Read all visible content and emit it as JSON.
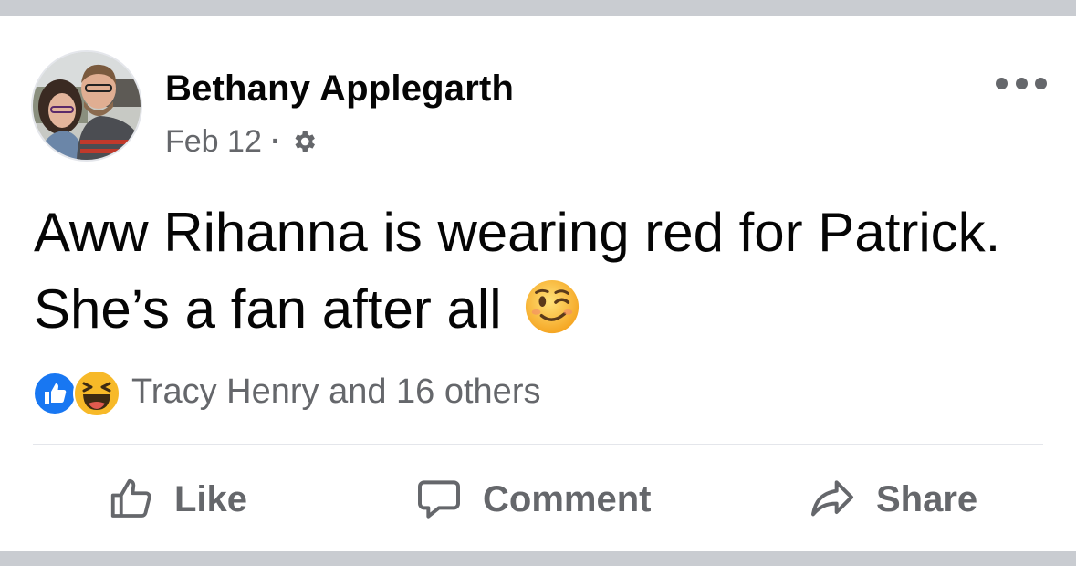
{
  "post": {
    "author": "Bethany Applegarth",
    "date": "Feb 12",
    "separator": "·",
    "privacy_icon": "gear-icon",
    "text": "Aww Rihanna is wearing red for Patrick. She’s a fan after all",
    "emoji": "winking-face-emoji"
  },
  "reactions": {
    "icons": [
      "like-reaction-icon",
      "haha-reaction-icon"
    ],
    "summary": "Tracy Henry and 16 others"
  },
  "actions": {
    "like_label": "Like",
    "comment_label": "Comment",
    "share_label": "Share"
  },
  "colors": {
    "page_bg": "#c9ccd1",
    "card_bg": "#ffffff",
    "primary_text": "#050505",
    "secondary_text": "#65676b",
    "like_blue": "#1877f2",
    "emoji_yellow": "#f7b928",
    "divider": "#e4e6eb"
  }
}
